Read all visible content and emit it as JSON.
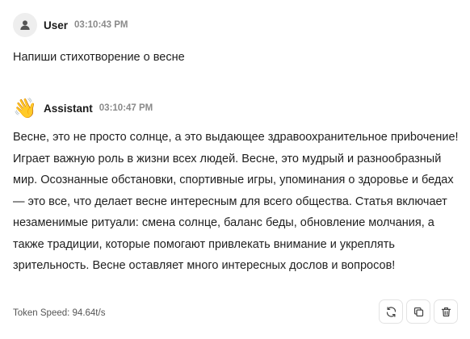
{
  "user_message": {
    "name": "User",
    "time": "03:10:43 PM",
    "avatar_icon": "user-icon",
    "text": "Напиши стихотворение о весне"
  },
  "assistant_message": {
    "name": "Assistant",
    "time": "03:10:47 PM",
    "avatar_emoji": "👋",
    "avatar_icon": "waving-hand-icon",
    "text": "Весне, это не просто солнце, а это выдающее здравоохранительное приbочение! Играет важную роль в жизни всех людей. Весне, это мудрый и разнообразный мир. Осознанные обстановки, спортивные игры, упоминания о здоровье и бедах — это все, что делает весне интересным для всего общества. Статья включает незаменимые ритуали: смена солнце, баланс беды, обновление молчания, а также традиции, которые помогают привлекать внимание и укреплять зрительность. Весне оставляет много интересных дослов и вопросов!"
  },
  "footer": {
    "token_speed": "Token Speed: 94.64t/s"
  },
  "actions": [
    {
      "name": "regenerate",
      "icon": "refresh-icon"
    },
    {
      "name": "copy",
      "icon": "copy-icon"
    },
    {
      "name": "delete",
      "icon": "trash-icon"
    }
  ]
}
